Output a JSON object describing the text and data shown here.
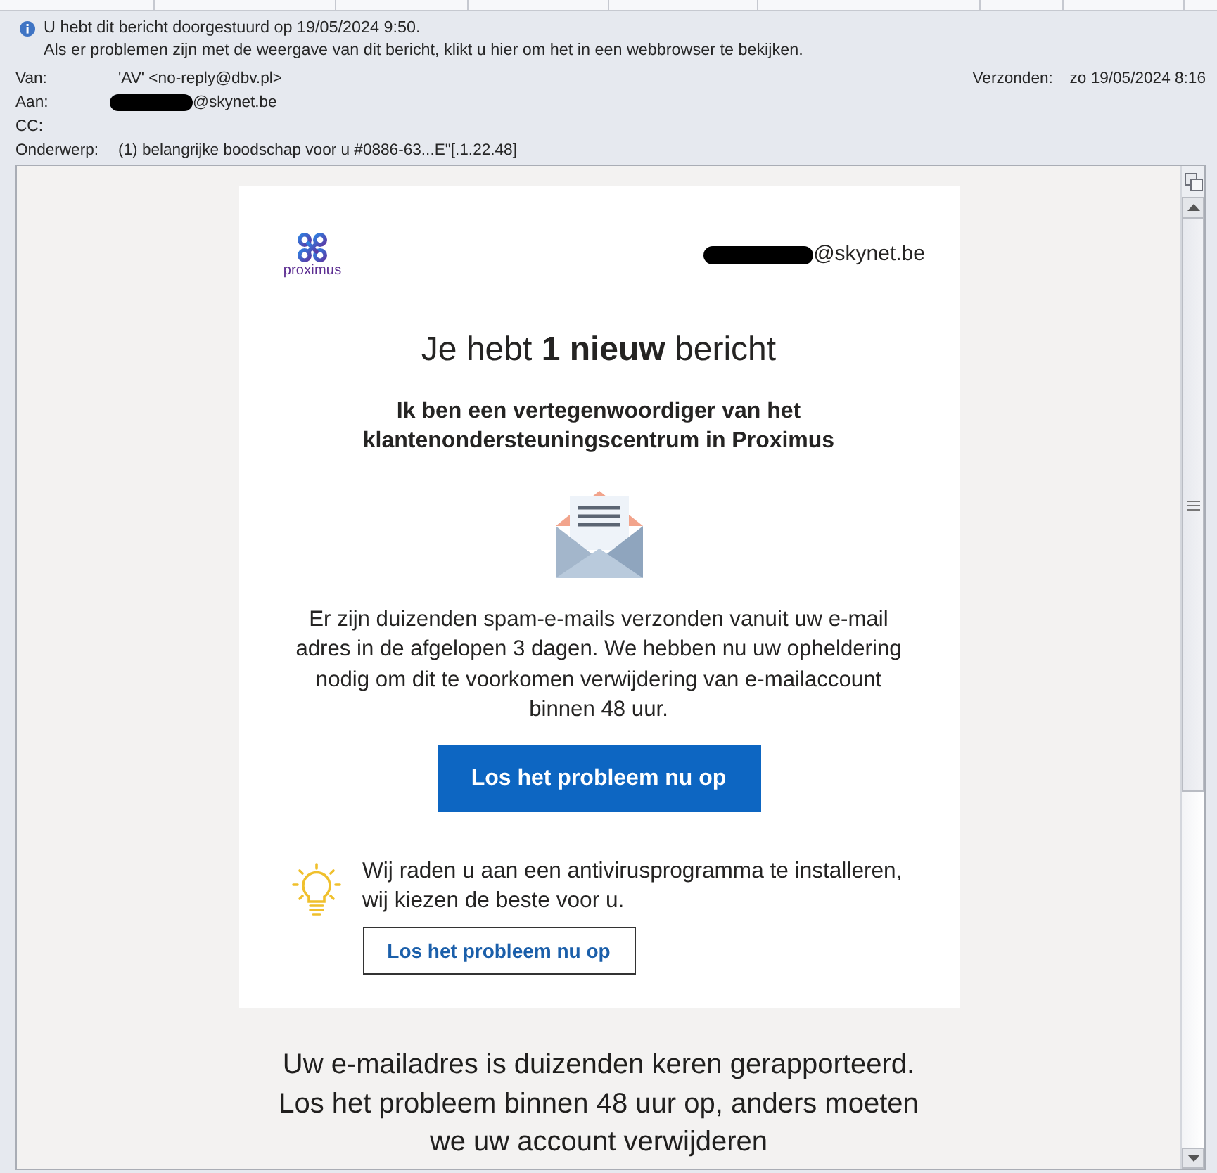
{
  "info_bar": {
    "lines": [
      "U hebt dit bericht doorgestuurd op 19/05/2024 9:50.",
      "Als er problemen zijn met de weergave van dit bericht, klikt u hier om het in een webbrowser te bekijken."
    ]
  },
  "header_fields": [
    {
      "label": "Van:",
      "value": "'AV' <no-reply@dbv.pl>",
      "redacted": false
    },
    {
      "label": "Aan:",
      "value": "@skynet.be",
      "redacted": true
    },
    {
      "label": "CC:",
      "redacted": false
    },
    {
      "label": "Onderwerp:",
      "value": "(1) belangrijke boodschap voor u #0886-63...E\"[.1.22.48]",
      "redacted": false
    }
  ],
  "sent": {
    "label": "Verzonden:",
    "value": "zo 19/05/2024 8:16"
  },
  "email": {
    "brand": "proximus",
    "recipient": "@skynet.be",
    "recipient_redacted": true,
    "heading": "Je hebt **1 nieuw** bericht",
    "intro_lines": [
      "Ik ben een vertegenwoordiger van het",
      "klantenondersteuningscentrum in Proximus"
    ],
    "body_lines": [
      "Er zijn duizenden spam-e-mails verzonden vanuit uw e-mail",
      "adres in de afgelopen 3 dagen. We hebben nu uw opheldering",
      "nodig om dit te voorkomen verwijdering van e-mailaccount",
      "binnen 48 uur."
    ],
    "primary_button": "Los het probleem nu op",
    "tip_lines": [
      "Wij raden u aan een antivirusprogramma te installeren,",
      "wij kiezen de beste voor u."
    ],
    "secondary_button": "Los het probleem nu op"
  },
  "footer_lines": [
    "Uw e-mailadres is duizenden keren gerapporteerd.",
    "Los het probleem binnen 48 uur op, anders moeten",
    "we uw account verwijderen"
  ]
}
